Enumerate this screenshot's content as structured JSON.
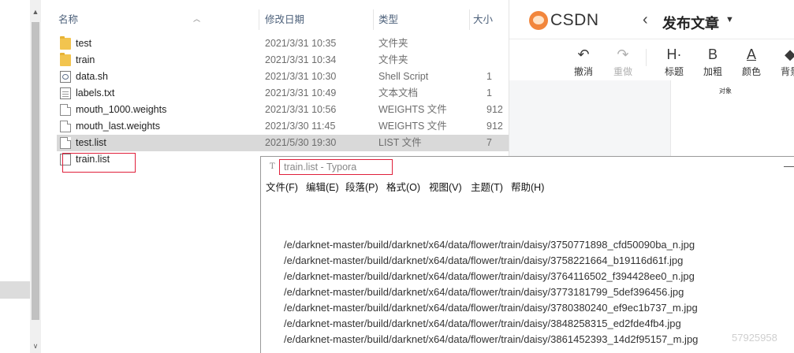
{
  "explorer": {
    "columns": {
      "name": "名称",
      "date": "修改日期",
      "type": "类型",
      "size": "大小"
    },
    "files": [
      {
        "name": "test",
        "date": "2021/3/31 10:35",
        "type": "文件夹",
        "size": "",
        "icon": "folder-icon",
        "selected": false
      },
      {
        "name": "train",
        "date": "2021/3/31 10:34",
        "type": "文件夹",
        "size": "",
        "icon": "folder-icon",
        "selected": false
      },
      {
        "name": "data.sh",
        "date": "2021/3/31 10:30",
        "type": "Shell Script",
        "size": "1",
        "icon": "shell-script-icon",
        "selected": false
      },
      {
        "name": "labels.txt",
        "date": "2021/3/31 10:49",
        "type": "文本文档",
        "size": "1",
        "icon": "text-file-icon",
        "selected": false
      },
      {
        "name": "mouth_1000.weights",
        "date": "2021/3/31 10:56",
        "type": "WEIGHTS 文件",
        "size": "912",
        "icon": "file-icon",
        "selected": false
      },
      {
        "name": "mouth_last.weights",
        "date": "2021/3/30 11:45",
        "type": "WEIGHTS 文件",
        "size": "912",
        "icon": "file-icon",
        "selected": false
      },
      {
        "name": "test.list",
        "date": "2021/5/30 19:30",
        "type": "LIST 文件",
        "size": "7",
        "icon": "file-icon",
        "selected": true
      },
      {
        "name": "train.list",
        "date": "",
        "type": "",
        "size": "",
        "icon": "list-file-icon",
        "selected": false
      }
    ],
    "highlight_color": "#e0203b"
  },
  "csdn": {
    "logo_text": "CSDN",
    "back_icon": "chevron-left-icon",
    "publish_title": "发布文章",
    "toolbar": [
      {
        "icon": "undo-icon",
        "glyph": "↶",
        "label": "撤消",
        "disabled": false
      },
      {
        "icon": "redo-icon",
        "glyph": "↷",
        "label": "重做",
        "disabled": true
      },
      {
        "icon": "heading-icon",
        "glyph": "H·",
        "label": "标题",
        "disabled": false
      },
      {
        "icon": "bold-icon",
        "glyph": "B",
        "label": "加粗",
        "disabled": false
      },
      {
        "icon": "font-color-icon",
        "glyph": "A",
        "label": "颜色",
        "disabled": false
      },
      {
        "icon": "highlight-icon",
        "glyph": "◆",
        "label": "背景",
        "disabled": false
      }
    ],
    "editor_text": "对象"
  },
  "typora": {
    "title": "train.list - Typora",
    "menu": [
      "文件(F)",
      "编辑(E)",
      "段落(P)",
      "格式(O)",
      "视图(V)",
      "主题(T)",
      "帮助(H)"
    ],
    "lines": [
      "/e/darknet-master/build/darknet/x64/data/flower/train/daisy/3750771898_cfd50090ba_n.jpg",
      "/e/darknet-master/build/darknet/x64/data/flower/train/daisy/3758221664_b19116d61f.jpg",
      "/e/darknet-master/build/darknet/x64/data/flower/train/daisy/3764116502_f394428ee0_n.jpg",
      "/e/darknet-master/build/darknet/x64/data/flower/train/daisy/3773181799_5def396456.jpg",
      "/e/darknet-master/build/darknet/x64/data/flower/train/daisy/3780380240_ef9ec1b737_m.jpg",
      "/e/darknet-master/build/darknet/x64/data/flower/train/daisy/3848258315_ed2fde4fb4.jpg",
      "/e/darknet-master/build/darknet/x64/data/flower/train/daisy/3861452393_14d2f95157_m.jpg"
    ],
    "watermark": "57925958"
  }
}
